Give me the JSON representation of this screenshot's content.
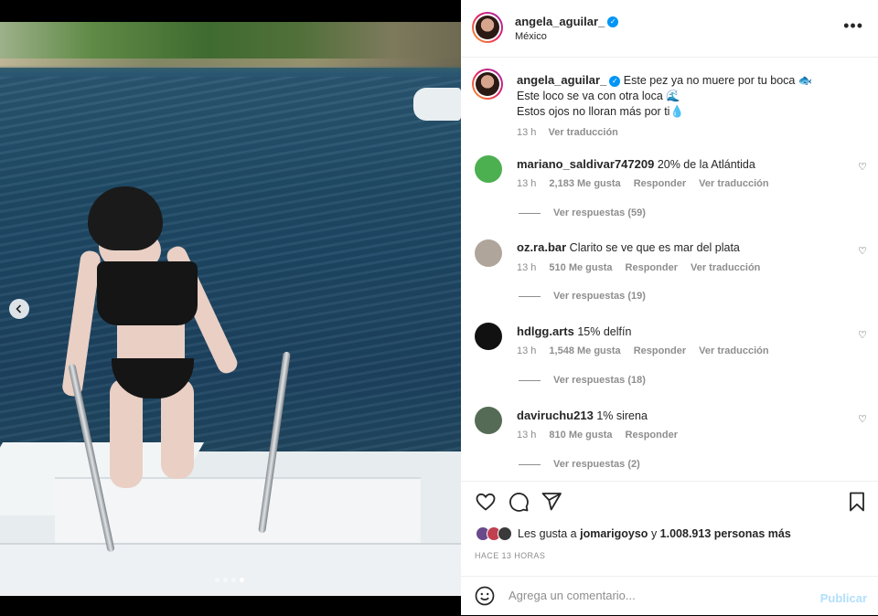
{
  "header": {
    "username": "angela_aguilar_",
    "location": "México",
    "more_icon": "ellipsis-icon"
  },
  "caption": {
    "username": "angela_aguilar_",
    "lines": [
      "Este pez ya no muere por tu boca 🐟",
      "Este loco se va con otra loca 🌊",
      "Estos ojos no lloran más por ti💧"
    ],
    "time": "13 h",
    "translate": "Ver traducción"
  },
  "comments": [
    {
      "username": "mariano_saldivar747209",
      "text": "20% de la Atlántida",
      "time": "13 h",
      "likes": "2,183 Me gusta",
      "reply": "Responder",
      "translate": "Ver traducción",
      "replies": "Ver respuestas (59)",
      "avatar_color": "#4caf50"
    },
    {
      "username": "oz.ra.bar",
      "text": "Clarito se ve que es mar del plata",
      "time": "13 h",
      "likes": "510 Me gusta",
      "reply": "Responder",
      "translate": "Ver traducción",
      "replies": "Ver respuestas (19)",
      "avatar_color": "#b0a59a"
    },
    {
      "username": "hdlgg.arts",
      "text": "15% delfín",
      "time": "13 h",
      "likes": "1,548 Me gusta",
      "reply": "Responder",
      "translate": "Ver traducción",
      "replies": "Ver respuestas (18)",
      "avatar_color": "#111111"
    },
    {
      "username": "daviruchu213",
      "text": "1% sirena",
      "time": "13 h",
      "likes": "810 Me gusta",
      "reply": "Responder",
      "translate": "",
      "replies": "Ver respuestas (2)",
      "avatar_color": "#556b55"
    }
  ],
  "actions": {
    "likes_prefix": "Les gusta a",
    "liker": "jomarigoyso",
    "likes_mid": "y",
    "likes_count": "1.008.913 personas más",
    "timestamp": "HACE 13 HORAS"
  },
  "composer": {
    "placeholder": "Agrega un comentario...",
    "publish": "Publicar"
  },
  "carousel": {
    "count": 4,
    "active": 4
  }
}
